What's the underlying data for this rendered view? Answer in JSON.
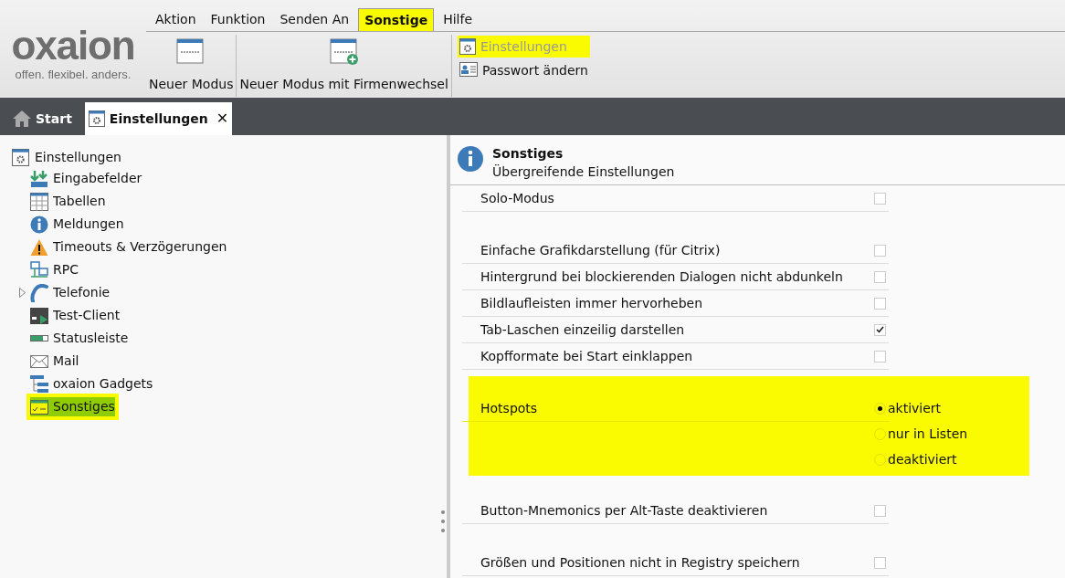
{
  "logo": {
    "name": "oxaion",
    "tagline": "offen. flexibel. anders."
  },
  "menu": [
    {
      "label": "Aktion",
      "highlighted": false
    },
    {
      "label": "Funktion",
      "highlighted": false
    },
    {
      "label": "Senden An",
      "highlighted": false
    },
    {
      "label": "Sonstige",
      "highlighted": true
    },
    {
      "label": "Hilfe",
      "highlighted": false
    }
  ],
  "ribbon": {
    "large_buttons": [
      {
        "label": "Neuer Modus"
      },
      {
        "label": "Neuer Modus mit Firmenwechsel"
      }
    ],
    "small_buttons": [
      {
        "label": "Einstellungen",
        "disabled": true,
        "highlighted": true
      },
      {
        "label": "Passwort ändern",
        "disabled": false,
        "highlighted": false
      }
    ]
  },
  "tabs": [
    {
      "label": "Start",
      "selected": false,
      "closable": false
    },
    {
      "label": "Einstellungen",
      "selected": true,
      "closable": true,
      "close": "✕"
    }
  ],
  "tree": {
    "label": "Einstellungen",
    "children": [
      {
        "label": "Eingabefelder",
        "selected": false,
        "highlighted": false
      },
      {
        "label": "Tabellen",
        "selected": false,
        "highlighted": false
      },
      {
        "label": "Meldungen",
        "selected": false,
        "highlighted": false
      },
      {
        "label": "Timeouts & Verzögerungen",
        "selected": false,
        "highlighted": false
      },
      {
        "label": "RPC",
        "selected": false,
        "highlighted": false
      },
      {
        "label": "Telefonie",
        "selected": false,
        "highlighted": false,
        "expanded": false
      },
      {
        "label": "Test-Client",
        "selected": false,
        "highlighted": false
      },
      {
        "label": "Statusleiste",
        "selected": false,
        "highlighted": false
      },
      {
        "label": "Mail",
        "selected": false,
        "highlighted": false
      },
      {
        "label": "oxaion Gadgets",
        "selected": false,
        "highlighted": false
      },
      {
        "label": "Sonstiges",
        "selected": true,
        "highlighted": true
      }
    ]
  },
  "panel": {
    "title": "Sonstiges",
    "subtitle": "Übergreifende Einstellungen",
    "groups": [
      {
        "highlighted": false,
        "items": [
          {
            "kind": "checkbox",
            "label": "Solo-Modus",
            "checked": false
          }
        ]
      },
      {
        "highlighted": false,
        "items": [
          {
            "kind": "checkbox",
            "label": "Einfache Grafikdarstellung (für Citrix)",
            "checked": false
          },
          {
            "kind": "checkbox",
            "label": "Hintergrund bei blockierenden Dialogen nicht abdunkeln",
            "checked": false
          },
          {
            "kind": "checkbox",
            "label": "Bildlaufleisten immer hervorheben",
            "checked": false
          },
          {
            "kind": "checkbox",
            "label": "Tab-Laschen einzeilig darstellen",
            "checked": true
          },
          {
            "kind": "checkbox",
            "label": "Kopfformate bei Start einklappen",
            "checked": false
          }
        ]
      },
      {
        "highlighted": true,
        "items": [
          {
            "kind": "radio",
            "label": "Hotspots",
            "options": [
              {
                "label": "aktiviert",
                "selected": true
              },
              {
                "label": "nur in Listen",
                "selected": false
              },
              {
                "label": "deaktiviert",
                "selected": false
              }
            ]
          }
        ]
      },
      {
        "highlighted": false,
        "items": [
          {
            "kind": "checkbox",
            "label": "Button-Mnemonics per Alt-Taste deaktivieren",
            "checked": false
          }
        ]
      },
      {
        "highlighted": false,
        "items": [
          {
            "kind": "checkbox",
            "label": "Größen und Positionen nicht in Registry speichern",
            "checked": false
          }
        ]
      }
    ]
  }
}
